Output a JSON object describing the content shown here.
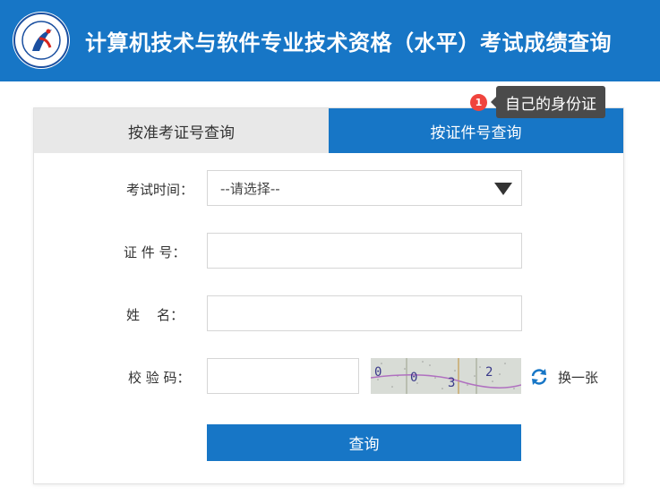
{
  "header": {
    "title": "计算机技术与软件专业技术资格（水平）考试成绩查询",
    "background_color": "#1776c6",
    "logo_icon": "exam-seal-logo",
    "logo_ring_text": "Computer Qualification Certification"
  },
  "tabs": [
    {
      "label": "按准考证号查询",
      "active": false
    },
    {
      "label": "按证件号查询",
      "active": true
    }
  ],
  "form": {
    "exam_time": {
      "label": "考试时间：",
      "selected": "--请选择--"
    },
    "id_number": {
      "label": "证 件 号：",
      "value": ""
    },
    "name": {
      "label": "姓    名：",
      "value": ""
    },
    "captcha": {
      "label": "校 验 码：",
      "value": "",
      "image_chars": "0 0 3 2",
      "refresh_label": "换一张",
      "refresh_icon": "refresh-icon"
    },
    "submit_label": "查询"
  },
  "tooltip": {
    "badge": "1",
    "text": "自己的身份证"
  },
  "colors": {
    "accent": "#1776c6",
    "tab_inactive": "#e8e8e8",
    "badge": "#f0443d",
    "tooltip_bg": "#4a4a4a"
  }
}
